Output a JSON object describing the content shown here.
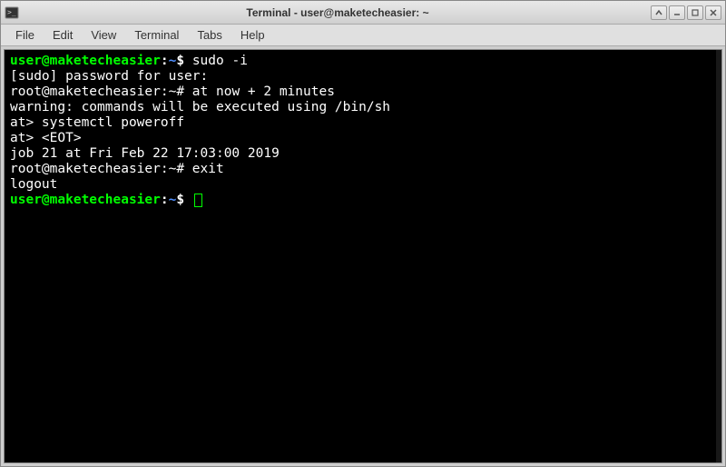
{
  "window": {
    "title": "Terminal - user@maketecheasier: ~"
  },
  "menu": {
    "file": "File",
    "edit": "Edit",
    "view": "View",
    "terminal": "Terminal",
    "tabs": "Tabs",
    "help": "Help"
  },
  "terminal": {
    "l1_user": "user@maketecheasier",
    "l1_sep": ":",
    "l1_path": "~",
    "l1_end": "$ ",
    "l1_cmd": "sudo -i",
    "l2": "[sudo] password for user:",
    "l3_prompt": "root@maketecheasier:~# ",
    "l3_cmd": "at now + 2 minutes",
    "l4": "warning: commands will be executed using /bin/sh",
    "l5": "at> systemctl poweroff",
    "l6": "at> <EOT>",
    "l7": "job 21 at Fri Feb 22 17:03:00 2019",
    "l8_prompt": "root@maketecheasier:~# ",
    "l8_cmd": "exit",
    "l9": "logout",
    "l10_user": "user@maketecheasier",
    "l10_sep": ":",
    "l10_path": "~",
    "l10_end": "$ "
  }
}
